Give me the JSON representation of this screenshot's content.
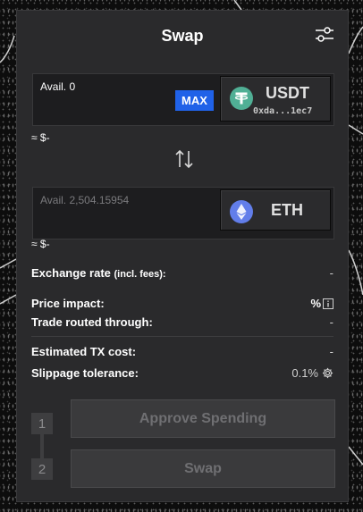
{
  "header": {
    "title": "Swap",
    "settings_icon": "sliders-icon"
  },
  "from": {
    "avail_label": "Avail. 0",
    "max_label": "MAX",
    "token": {
      "symbol": "USDT",
      "address": "0xda...1ec7",
      "icon": "tether-icon",
      "color": "#50af95"
    },
    "usd_value": "≈ $-"
  },
  "switch_icon": "swap-arrows-icon",
  "to": {
    "avail_label": "Avail. 2,504.15954",
    "token": {
      "symbol": "ETH",
      "icon": "ethereum-icon",
      "color": "#627eea"
    },
    "usd_value": "≈ $-"
  },
  "info": {
    "exchange_rate": {
      "label": "Exchange rate",
      "sub": "(incl. fees):",
      "value": "-"
    },
    "price_impact": {
      "label": "Price impact:",
      "value": "%"
    },
    "trade_routed": {
      "label": "Trade routed through:",
      "value": "-"
    },
    "tx_cost": {
      "label": "Estimated TX cost:",
      "value": "-"
    },
    "slippage": {
      "label": "Slippage tolerance:",
      "value": "0.1%"
    }
  },
  "steps": [
    {
      "number": "1",
      "label": "Approve Spending"
    },
    {
      "number": "2",
      "label": "Swap"
    }
  ],
  "colors": {
    "accent": "#2062e8",
    "panel": "#2a2a2c",
    "input_bg": "#1d1d1f"
  }
}
